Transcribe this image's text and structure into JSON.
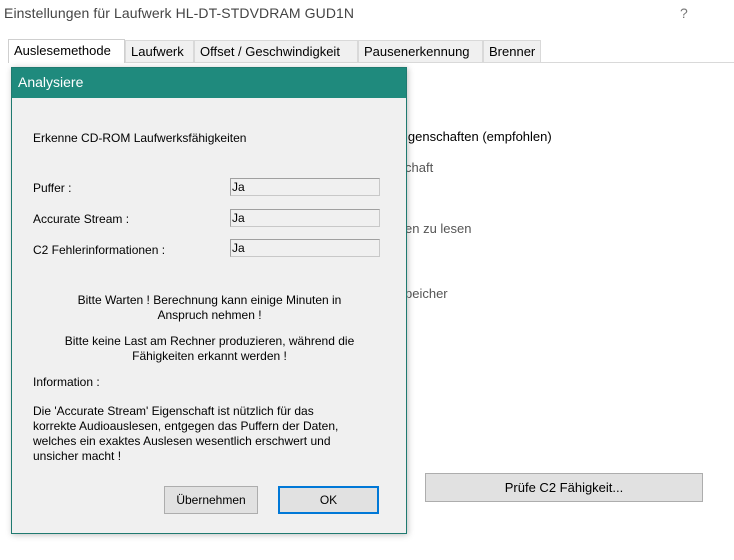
{
  "window": {
    "title": "Einstellungen für Laufwerk HL-DT-STDVDRAM GUD1N",
    "help": "?"
  },
  "tabs": [
    {
      "label": "Auslesemethode",
      "active": true
    },
    {
      "label": "Laufwerk"
    },
    {
      "label": "Offset / Geschwindigkeit"
    },
    {
      "label": "Pausenerkennung"
    },
    {
      "label": "Brenner"
    }
  ],
  "background": {
    "line1": "igenschaften (empfohlen)",
    "line2": "chaft",
    "line3": "en zu lesen",
    "line4": "peicher",
    "c2_button": "Prüfe C2 Fähigkeit..."
  },
  "dialog": {
    "title": "Analysiere",
    "heading": "Erkenne CD-ROM Laufwerksfähigkeiten",
    "rows": [
      {
        "label": "Puffer :",
        "value": "Ja"
      },
      {
        "label": "Accurate Stream :",
        "value": "Ja"
      },
      {
        "label": "C2 Fehlerinformationen :",
        "value": "Ja"
      }
    ],
    "wait_line1": "Bitte Warten !  Berechnung kann einige Minuten in",
    "wait_line2": "Anspruch nehmen !",
    "load_line1": "Bitte keine Last am Rechner produzieren, während die",
    "load_line2": "Fähigkeiten erkannt werden !",
    "info_label": "Information :",
    "info_lines": [
      "Die 'Accurate Stream' Eigenschaft ist nützlich für das",
      "korrekte Audioauslesen, entgegen das Puffern der Daten,",
      "welches ein exaktes Auslesen wesentlich erschwert und",
      "unsicher macht !"
    ],
    "apply_button": "Übernehmen",
    "ok_button": "OK"
  },
  "colors": {
    "dialog_titlebar": "#1f8a7d",
    "default_button_border": "#0078d7"
  }
}
